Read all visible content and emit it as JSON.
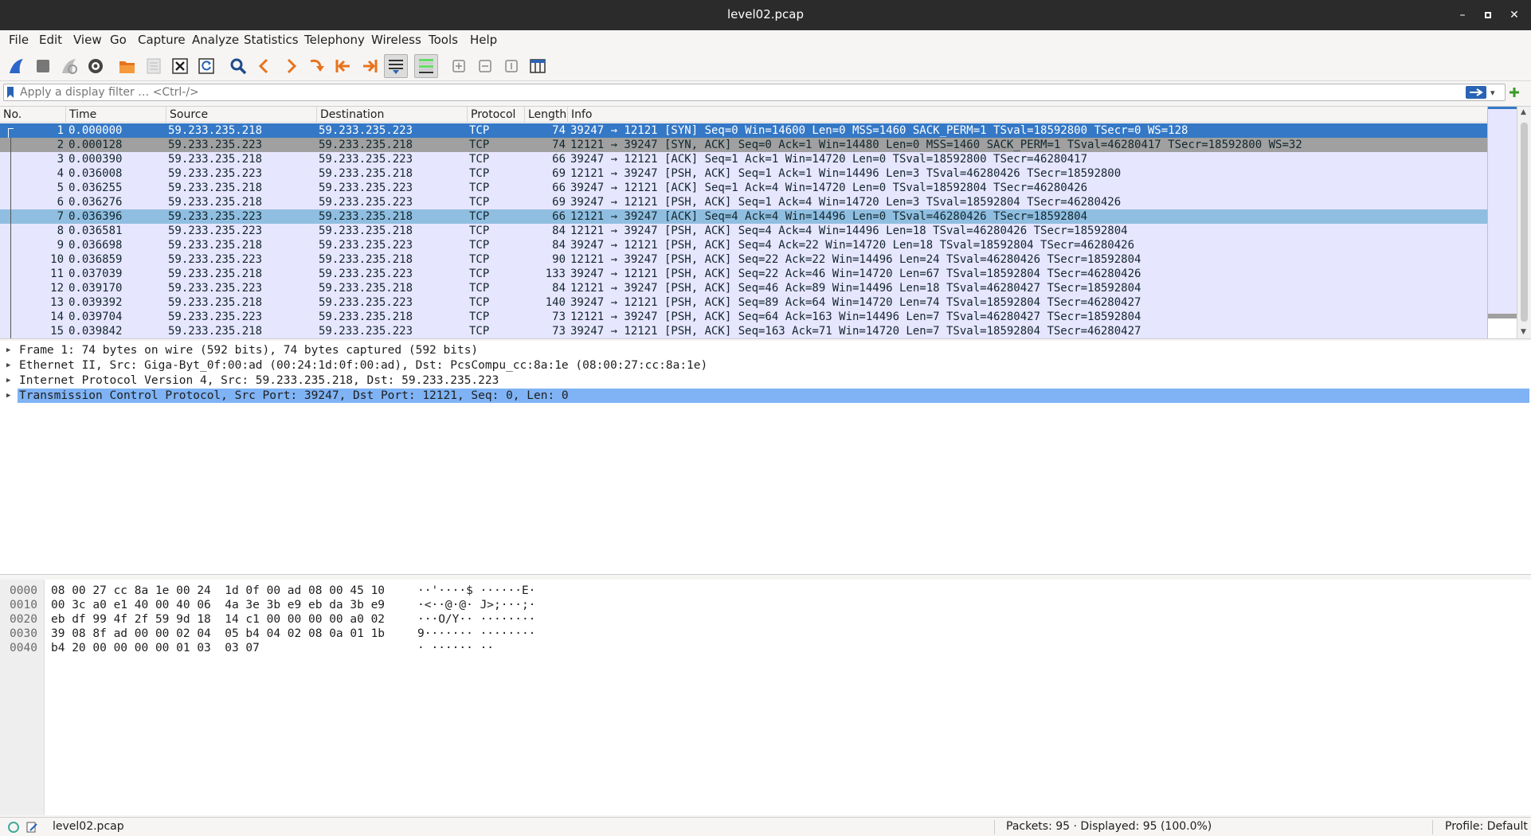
{
  "window": {
    "title": "level02.pcap"
  },
  "menu": [
    "File",
    "Edit",
    "View",
    "Go",
    "Capture",
    "Analyze",
    "Statistics",
    "Telephony",
    "Wireless",
    "Tools",
    "Help"
  ],
  "filter": {
    "placeholder": "Apply a display filter … <Ctrl-/>"
  },
  "columns": [
    "No.",
    "Time",
    "Source",
    "Destination",
    "Protocol",
    "Length",
    "Info"
  ],
  "packets": [
    {
      "no": "1",
      "time": "0.000000",
      "src": "59.233.235.218",
      "dst": "59.233.235.223",
      "proto": "TCP",
      "len": "74",
      "info": "39247 → 12121 [SYN] Seq=0 Win=14600 Len=0 MSS=1460 SACK_PERM=1 TSval=18592800 TSecr=0 WS=128"
    },
    {
      "no": "2",
      "time": "0.000128",
      "src": "59.233.235.223",
      "dst": "59.233.235.218",
      "proto": "TCP",
      "len": "74",
      "info": "12121 → 39247 [SYN, ACK] Seq=0 Ack=1 Win=14480 Len=0 MSS=1460 SACK_PERM=1 TSval=46280417 TSecr=18592800 WS=32"
    },
    {
      "no": "3",
      "time": "0.000390",
      "src": "59.233.235.218",
      "dst": "59.233.235.223",
      "proto": "TCP",
      "len": "66",
      "info": "39247 → 12121 [ACK] Seq=1 Ack=1 Win=14720 Len=0 TSval=18592800 TSecr=46280417"
    },
    {
      "no": "4",
      "time": "0.036008",
      "src": "59.233.235.223",
      "dst": "59.233.235.218",
      "proto": "TCP",
      "len": "69",
      "info": "12121 → 39247 [PSH, ACK] Seq=1 Ack=1 Win=14496 Len=3 TSval=46280426 TSecr=18592800"
    },
    {
      "no": "5",
      "time": "0.036255",
      "src": "59.233.235.218",
      "dst": "59.233.235.223",
      "proto": "TCP",
      "len": "66",
      "info": "39247 → 12121 [ACK] Seq=1 Ack=4 Win=14720 Len=0 TSval=18592804 TSecr=46280426"
    },
    {
      "no": "6",
      "time": "0.036276",
      "src": "59.233.235.218",
      "dst": "59.233.235.223",
      "proto": "TCP",
      "len": "69",
      "info": "39247 → 12121 [PSH, ACK] Seq=1 Ack=4 Win=14720 Len=3 TSval=18592804 TSecr=46280426"
    },
    {
      "no": "7",
      "time": "0.036396",
      "src": "59.233.235.223",
      "dst": "59.233.235.218",
      "proto": "TCP",
      "len": "66",
      "info": "12121 → 39247 [ACK] Seq=4 Ack=4 Win=14496 Len=0 TSval=46280426 TSecr=18592804"
    },
    {
      "no": "8",
      "time": "0.036581",
      "src": "59.233.235.223",
      "dst": "59.233.235.218",
      "proto": "TCP",
      "len": "84",
      "info": "12121 → 39247 [PSH, ACK] Seq=4 Ack=4 Win=14496 Len=18 TSval=46280426 TSecr=18592804"
    },
    {
      "no": "9",
      "time": "0.036698",
      "src": "59.233.235.218",
      "dst": "59.233.235.223",
      "proto": "TCP",
      "len": "84",
      "info": "39247 → 12121 [PSH, ACK] Seq=4 Ack=22 Win=14720 Len=18 TSval=18592804 TSecr=46280426"
    },
    {
      "no": "10",
      "time": "0.036859",
      "src": "59.233.235.223",
      "dst": "59.233.235.218",
      "proto": "TCP",
      "len": "90",
      "info": "12121 → 39247 [PSH, ACK] Seq=22 Ack=22 Win=14496 Len=24 TSval=46280426 TSecr=18592804"
    },
    {
      "no": "11",
      "time": "0.037039",
      "src": "59.233.235.218",
      "dst": "59.233.235.223",
      "proto": "TCP",
      "len": "133",
      "info": "39247 → 12121 [PSH, ACK] Seq=22 Ack=46 Win=14720 Len=67 TSval=18592804 TSecr=46280426"
    },
    {
      "no": "12",
      "time": "0.039170",
      "src": "59.233.235.223",
      "dst": "59.233.235.218",
      "proto": "TCP",
      "len": "84",
      "info": "12121 → 39247 [PSH, ACK] Seq=46 Ack=89 Win=14496 Len=18 TSval=46280427 TSecr=18592804"
    },
    {
      "no": "13",
      "time": "0.039392",
      "src": "59.233.235.218",
      "dst": "59.233.235.223",
      "proto": "TCP",
      "len": "140",
      "info": "39247 → 12121 [PSH, ACK] Seq=89 Ack=64 Win=14720 Len=74 TSval=18592804 TSecr=46280427"
    },
    {
      "no": "14",
      "time": "0.039704",
      "src": "59.233.235.223",
      "dst": "59.233.235.218",
      "proto": "TCP",
      "len": "73",
      "info": "12121 → 39247 [PSH, ACK] Seq=64 Ack=163 Win=14496 Len=7 TSval=46280427 TSecr=18592804"
    },
    {
      "no": "15",
      "time": "0.039842",
      "src": "59.233.235.218",
      "dst": "59.233.235.223",
      "proto": "TCP",
      "len": "73",
      "info": "39247 → 12121 [PSH, ACK] Seq=163 Ack=71 Win=14720 Len=7 TSval=18592804 TSecr=46280427"
    }
  ],
  "row_states": {
    "selected": "1",
    "gray": "2",
    "related": "7"
  },
  "details": [
    "Frame 1: 74 bytes on wire (592 bits), 74 bytes captured (592 bits)",
    "Ethernet II, Src: Giga-Byt_0f:00:ad (00:24:1d:0f:00:ad), Dst: PcsCompu_cc:8a:1e (08:00:27:cc:8a:1e)",
    "Internet Protocol Version 4, Src: 59.233.235.218, Dst: 59.233.235.223",
    "Transmission Control Protocol, Src Port: 39247, Dst Port: 12121, Seq: 0, Len: 0"
  ],
  "bytes": [
    {
      "off": "0000",
      "hex": "08 00 27 cc 8a 1e 00 24  1d 0f 00 ad 08 00 45 10",
      "ascii": "··'····$ ······E·"
    },
    {
      "off": "0010",
      "hex": "00 3c a0 e1 40 00 40 06  4a 3e 3b e9 eb da 3b e9",
      "ascii": "·<··@·@· J>;···;·"
    },
    {
      "off": "0020",
      "hex": "eb df 99 4f 2f 59 9d 18  14 c1 00 00 00 00 a0 02",
      "ascii": "···O/Y·· ········"
    },
    {
      "off": "0030",
      "hex": "39 08 8f ad 00 00 02 04  05 b4 04 02 08 0a 01 1b",
      "ascii": "9······· ········"
    },
    {
      "off": "0040",
      "hex": "b4 20 00 00 00 00 01 03  03 07",
      "ascii": "· ······ ··"
    }
  ],
  "status": {
    "file": "level02.pcap",
    "packets": "Packets: 95 · Displayed: 95 (100.0%)",
    "profile": "Profile: Default"
  },
  "colors": {
    "selected": "#3478c6",
    "tcp_row": "#e7e6ff",
    "related": "#90bee0",
    "gray": "#a0a0a0",
    "detail_sel": "#7fb3f5"
  }
}
